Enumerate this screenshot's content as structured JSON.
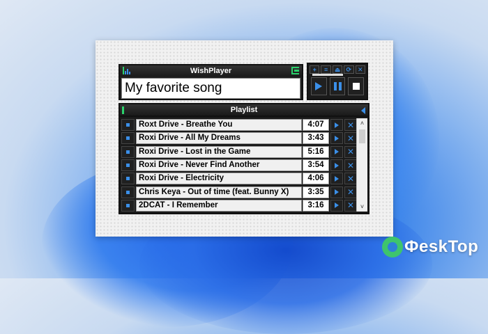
{
  "app": {
    "title": "WishPlayer"
  },
  "now_playing": {
    "song": "My favorite song"
  },
  "controls": {
    "top_icons": [
      "add-icon",
      "list-icon",
      "eject-icon",
      "repeat-icon",
      "close-icon"
    ],
    "top_glyphs": [
      "+",
      "≡",
      "⏏",
      "⟳",
      "✕"
    ],
    "buttons": [
      "play",
      "pause",
      "stop"
    ]
  },
  "playlist": {
    "title": "Playlist",
    "items": [
      {
        "name": "Roxt Drive - Breathe You",
        "duration": "4:07"
      },
      {
        "name": "Roxi Drive - All My Dreams",
        "duration": "3:43"
      },
      {
        "name": "Roxi Drive - Lost in the Game",
        "duration": "5:16"
      },
      {
        "name": "Roxi Drive - Never Find Another",
        "duration": "3:54"
      },
      {
        "name": "Roxi Drive -  Electricity",
        "duration": "4:06"
      },
      {
        "name": "Chris Keya - Out of time (feat. Bunny X)",
        "duration": "3:35"
      },
      {
        "name": "2DCAT - I Remember",
        "duration": "3:16"
      }
    ],
    "scroll_up": "˄",
    "scroll_down": "˅"
  },
  "watermark": {
    "text": "ФeskTop"
  },
  "colors": {
    "accent": "#3b8fe8",
    "green": "#2bd16b",
    "chrome": "#1a1a1a"
  }
}
